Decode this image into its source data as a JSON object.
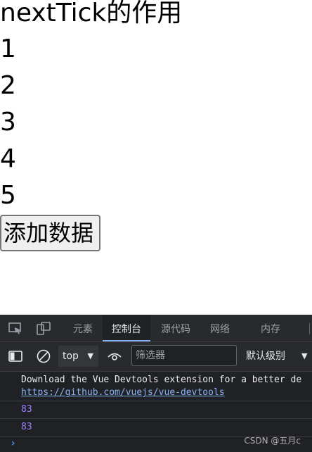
{
  "page": {
    "title": "nextTick的作用",
    "items": [
      "1",
      "2",
      "3",
      "4",
      "5"
    ],
    "add_button_label": "添加数据"
  },
  "devtools": {
    "tabs": [
      {
        "label": "元素",
        "active": false
      },
      {
        "label": "控制台",
        "active": true
      },
      {
        "label": "源代码",
        "active": false
      },
      {
        "label": "网络",
        "active": false
      },
      {
        "label": "内存",
        "active": false
      }
    ],
    "toolbar": {
      "context": "top",
      "filter_placeholder": "筛选器",
      "level_label": "默认级别"
    },
    "console": {
      "message": "Download the Vue Devtools extension for a better de",
      "link": "https://github.com/vuejs/vue-devtools",
      "logs": [
        "83",
        "83"
      ],
      "prompt": "›"
    },
    "colors": {
      "background": "#202124",
      "toolbar": "#292a2d",
      "accent": "#8ab4f8",
      "number": "#9980ff"
    }
  },
  "watermark": "CSDN @五月c"
}
